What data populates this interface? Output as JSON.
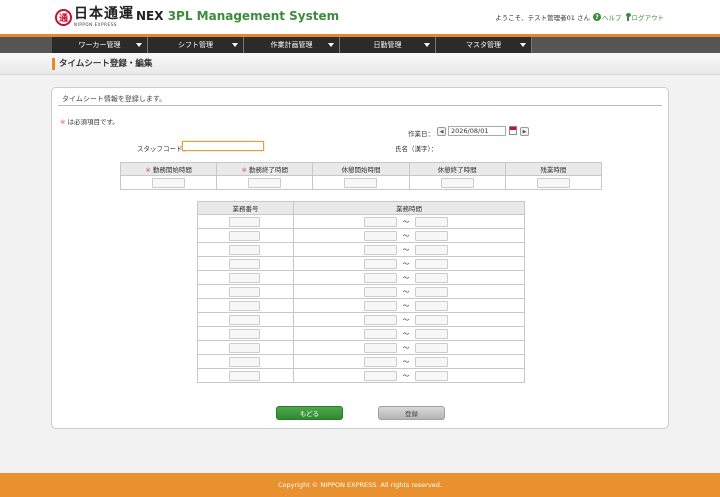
{
  "header": {
    "logo_mark": "通",
    "logo_jp": "日本通運",
    "logo_en": "NIPPON EXPRESS",
    "system_prefix": "NEX",
    "system_name": "3PL Management System",
    "welcome": "ようこそ、テスト管理者01 さん",
    "help_label": "ヘルプ",
    "logout_label": "ログアウト",
    "help_icon_glyph": "?"
  },
  "nav": {
    "items": [
      {
        "label": "ワーカー管理"
      },
      {
        "label": "シフト管理"
      },
      {
        "label": "作業計画管理"
      },
      {
        "label": "日勤管理"
      },
      {
        "label": "マスタ管理"
      }
    ]
  },
  "page": {
    "title": "タイムシート登録・編集"
  },
  "form": {
    "heading": "タイムシート情報を登録します。",
    "required_mark": "※",
    "required_note": "は必須項目です。",
    "work_date_label": "作業日：",
    "work_date_value": "2026/08/01",
    "prev_glyph": "◀",
    "next_glyph": "▶",
    "staff_code_label": "スタッフコード：",
    "staff_code_value": "",
    "name_label": "氏名（漢字）：",
    "name_value": ""
  },
  "time_table": {
    "headers": [
      {
        "label": "勤務開始時間",
        "required": true
      },
      {
        "label": "勤務終了時間",
        "required": true
      },
      {
        "label": "休憩開始時間",
        "required": false
      },
      {
        "label": "休憩終了時間",
        "required": false
      },
      {
        "label": "残業時間",
        "required": false
      }
    ]
  },
  "task_table": {
    "headers": [
      "業務番号",
      "業務時間"
    ],
    "separator": "〜",
    "row_count": 12
  },
  "buttons": {
    "back": "もどる",
    "save": "登録"
  },
  "footer": {
    "copyright": "Copyright © NIPPON EXPRESS. All rights reserved."
  },
  "colors": {
    "accent_orange": "#e4882a",
    "brand_green": "#3c8c3c",
    "brand_red": "#c8102e",
    "nav_dark": "#2b2b2b"
  }
}
